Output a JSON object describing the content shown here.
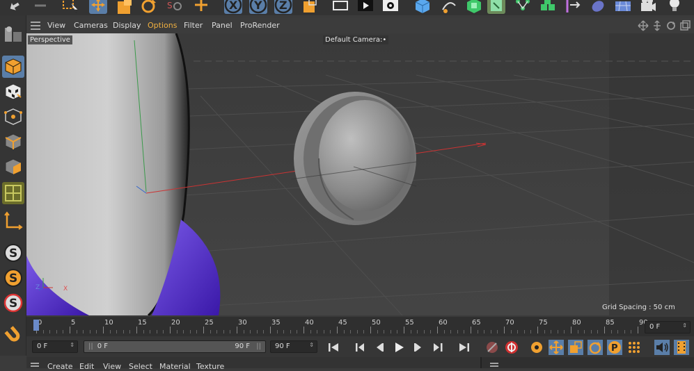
{
  "menu": {
    "items": [
      "View",
      "Cameras",
      "Display",
      "Options",
      "Filter",
      "Panel",
      "ProRender"
    ]
  },
  "viewport": {
    "view_label": "Perspective",
    "camera_label": "Default Camera",
    "camera_suffix": ":•",
    "grid_spacing": "Grid Spacing : 50 cm",
    "axis_z": "Z",
    "axis_x": "X"
  },
  "timeline": {
    "ticks": [
      "0",
      "5",
      "10",
      "15",
      "20",
      "25",
      "30",
      "35",
      "40",
      "45",
      "50",
      "55",
      "60",
      "65",
      "70",
      "75",
      "80",
      "85",
      "90"
    ],
    "current_frame": "0 F"
  },
  "transport": {
    "start_field": "0 F",
    "range_start": "0 F",
    "range_end": "90 F",
    "end_field": "90 F"
  },
  "bottom_menu": {
    "items": [
      "Create",
      "Edit",
      "View",
      "Select",
      "Material",
      "Texture"
    ]
  },
  "colors": {
    "accent_blue": "#5a7ea8",
    "orange": "#f0a030",
    "purple": "#6a3fd8"
  },
  "icons": {
    "top": [
      "undo-icon",
      "redo-icon",
      "select-icon",
      "move-icon",
      "scale-icon",
      "rotate-icon",
      "recent-icon",
      "add-icon",
      "x-axis-icon",
      "y-axis-icon",
      "z-axis-icon",
      "coord-icon",
      "render-region-icon",
      "render-view-icon",
      "render-settings-icon",
      "cube-icon",
      "pen-icon",
      "subdivision-icon",
      "generator-icon",
      "array-icon",
      "cloner-icon",
      "deformer-icon",
      "sculpt-icon",
      "floor-icon",
      "camera-icon",
      "light-icon"
    ],
    "left": [
      "make-editable-icon",
      "model-mode-icon",
      "texture-mode-icon",
      "points-mode-icon",
      "edges-mode-icon",
      "polygons-mode-icon",
      "uv-mode-icon",
      "axis-mode-icon",
      "snap-icon",
      "snap-settings-icon",
      "workplane-icon",
      "magnet-icon"
    ]
  }
}
